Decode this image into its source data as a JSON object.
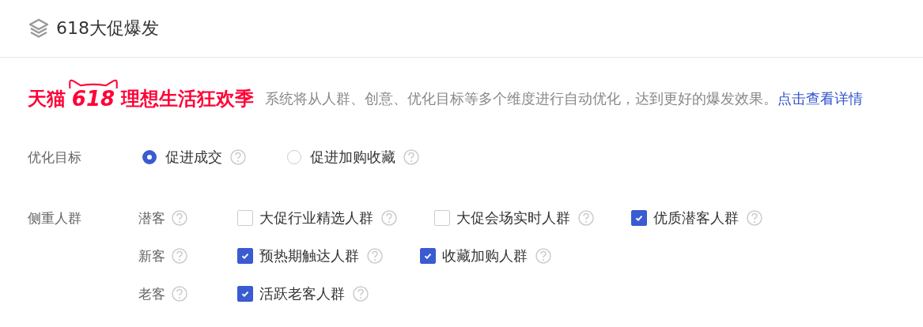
{
  "header": {
    "title": "618大促爆发"
  },
  "banner": {
    "logo": {
      "brand": "天猫",
      "number": "618",
      "slogan": "理想生活狂欢季"
    },
    "description": "系统将从人群、创意、优化目标等多个维度进行自动优化，达到更好的爆发效果。",
    "link": "点击查看详情"
  },
  "goal": {
    "label": "优化目标",
    "options": [
      {
        "label": "促进成交",
        "selected": true
      },
      {
        "label": "促进加购收藏",
        "selected": false
      }
    ]
  },
  "audience": {
    "label": "侧重人群",
    "groups": [
      {
        "label": "潜客",
        "options": [
          {
            "label": "大促行业精选人群",
            "checked": false
          },
          {
            "label": "大促会场实时人群",
            "checked": false
          },
          {
            "label": "优质潜客人群",
            "checked": true
          }
        ]
      },
      {
        "label": "新客",
        "options": [
          {
            "label": "预热期触达人群",
            "checked": true
          },
          {
            "label": "收藏加购人群",
            "checked": true
          }
        ]
      },
      {
        "label": "老客",
        "options": [
          {
            "label": "活跃老客人群",
            "checked": true
          }
        ]
      }
    ]
  }
}
